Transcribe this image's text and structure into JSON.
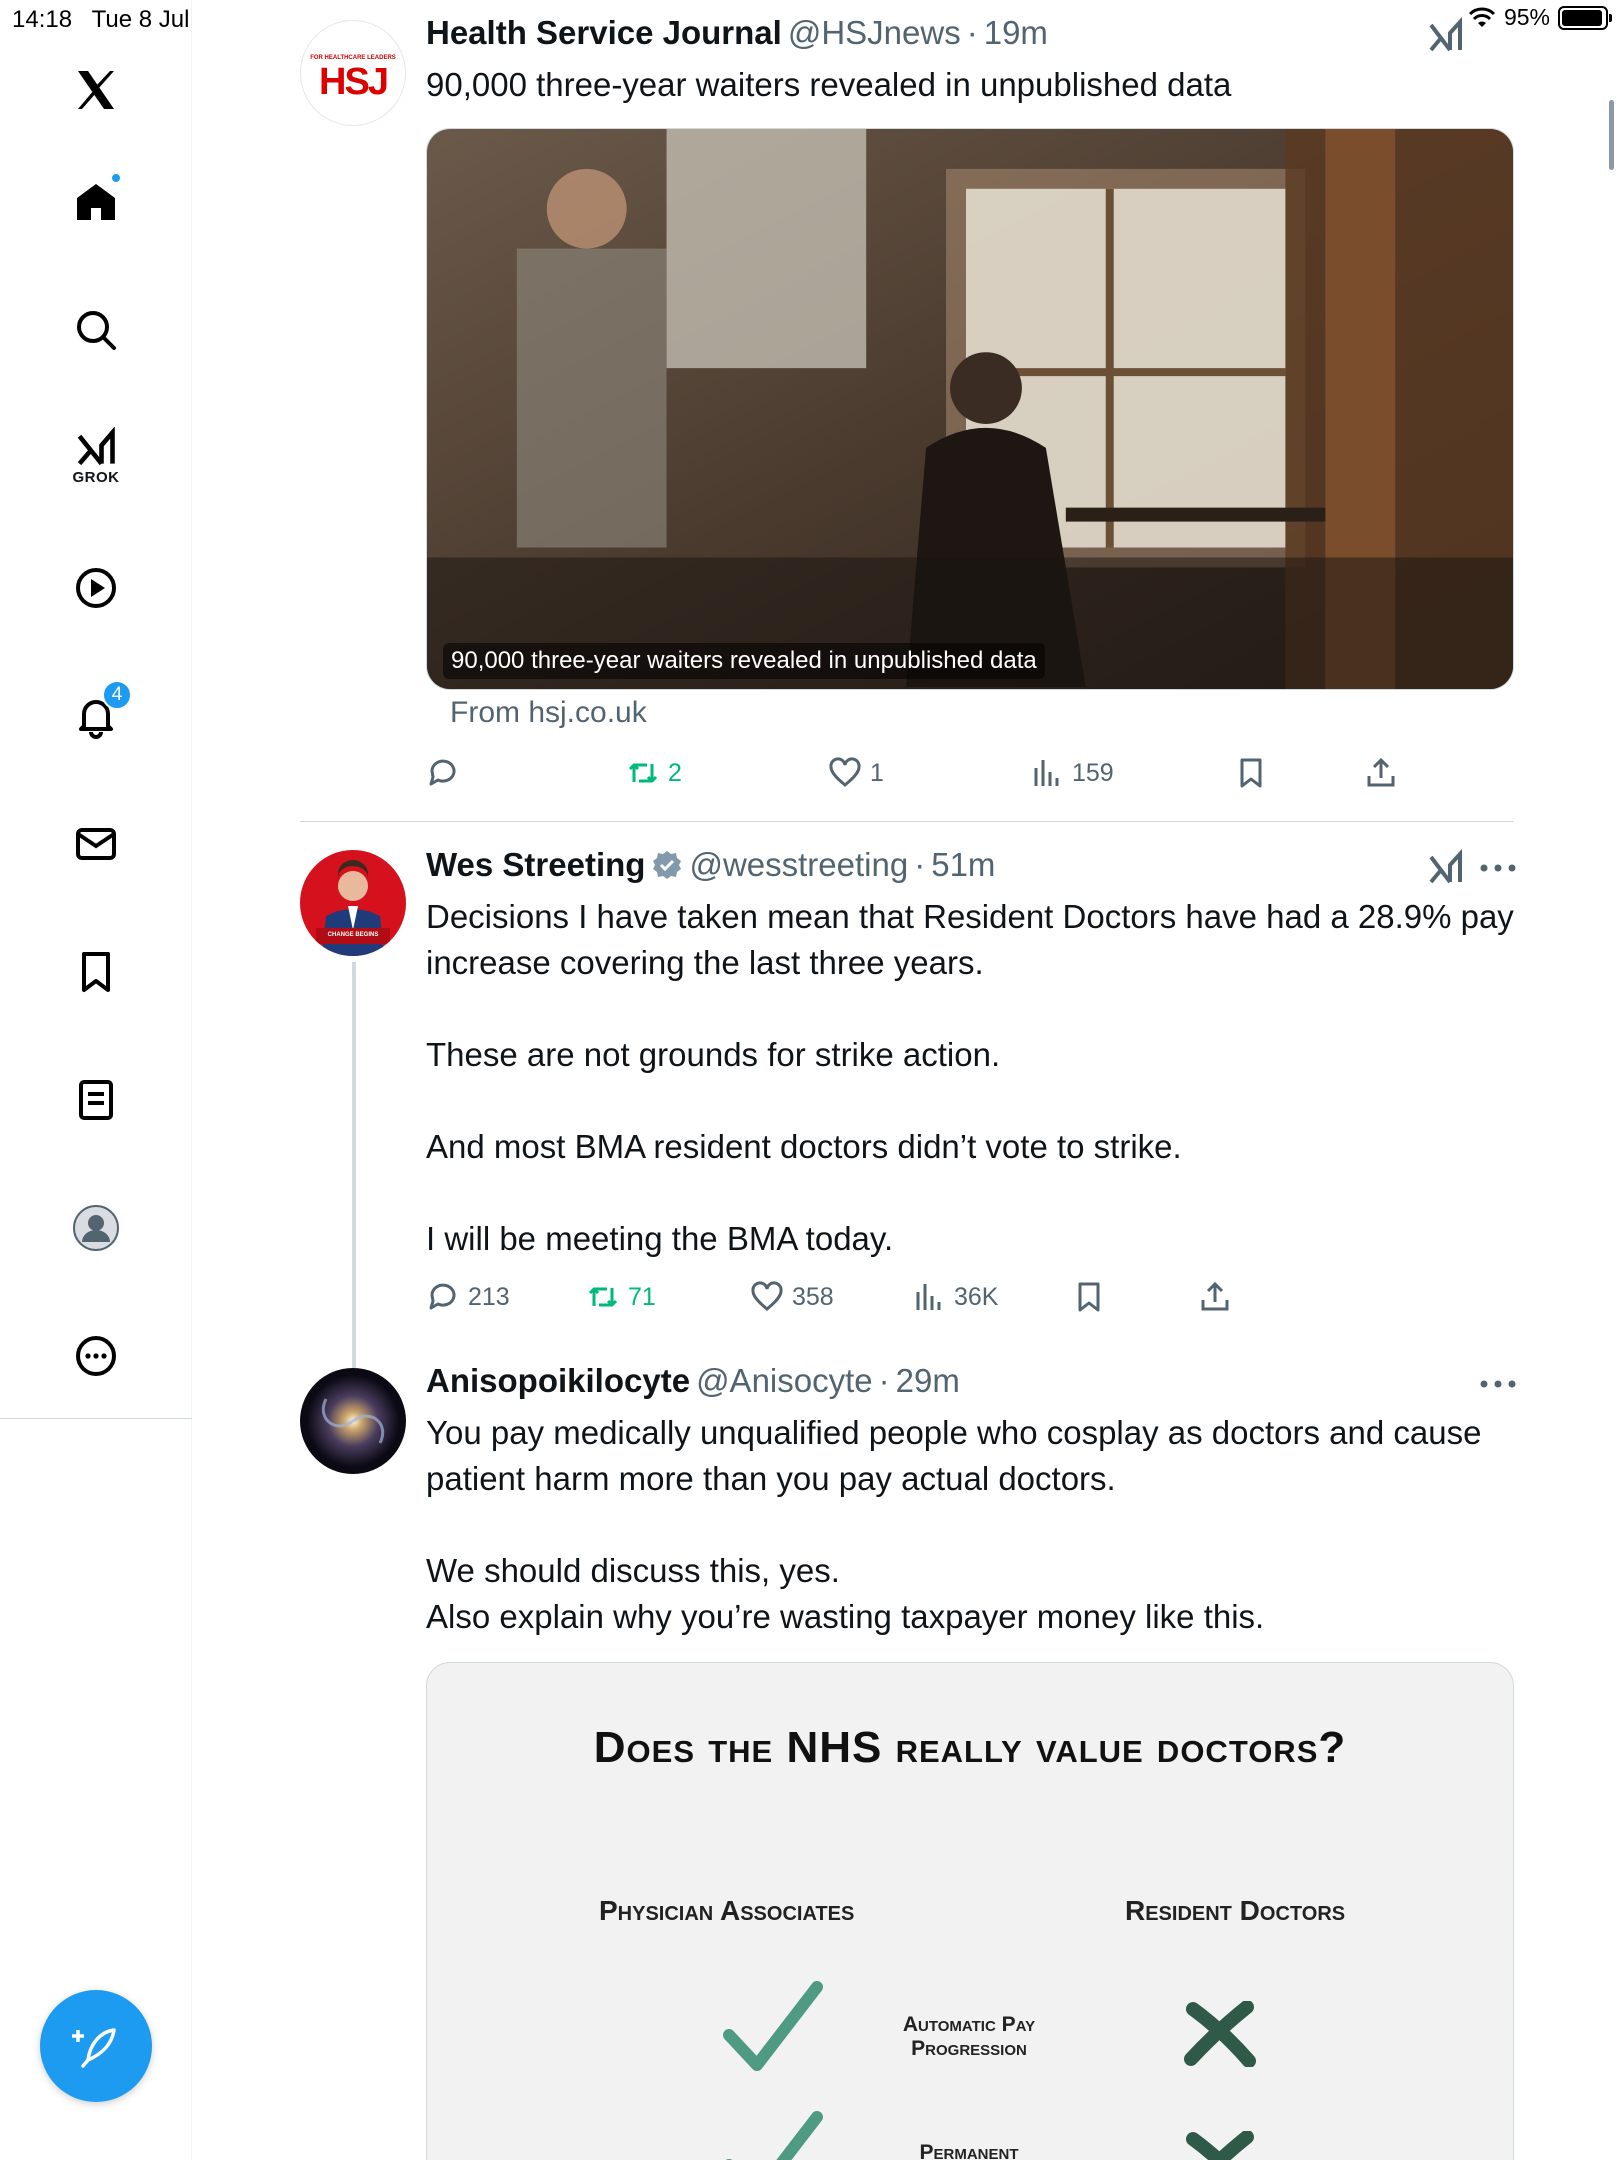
{
  "status_bar": {
    "time": "14:18",
    "date": "Tue 8 Jul",
    "battery": "95%",
    "battery_level": 0.95
  },
  "sidebar": {
    "grok_label": "GROK",
    "notifications_count": "4"
  },
  "tweets": [
    {
      "name": "Health Service Journal",
      "handle": "@HSJnews",
      "time": "19m",
      "text": "90,000 three-year waiters revealed in unpublished data",
      "avatar_text": "HSJ",
      "avatar_tagline": "FOR HEALTHCARE LEADERS",
      "card": {
        "overlay_title": "90,000 three-year waiters revealed in unpublished data",
        "source": "From hsj.co.uk"
      },
      "stats": {
        "reposts": "2",
        "likes": "1",
        "views": "159"
      }
    },
    {
      "name": "Wes Streeting",
      "handle": "@wesstreeting",
      "time": "51m",
      "verified": true,
      "paragraphs": [
        "Decisions I have taken mean that Resident Doctors have had a 28.9% pay increase covering the last three years.",
        "These are not grounds for strike action.",
        "And most BMA resident doctors didn’t vote to strike.",
        "I will be meeting the BMA today."
      ],
      "avatar_banner": "CHANGE BEGINS",
      "stats": {
        "replies": "213",
        "reposts": "71",
        "likes": "358",
        "views": "36K"
      }
    },
    {
      "name": "Anisopoikilocyte",
      "handle": "@Anisocyte",
      "time": "29m",
      "paragraphs": [
        "You pay medically unqualified people who cosplay as doctors and cause patient harm more than you pay actual doctors.",
        "",
        "We should discuss this, yes.",
        "Also explain why you’re wasting taxpayer money like this."
      ],
      "infographic": {
        "title": "Does the NHS really value doctors?",
        "col_left": "Physician Associates",
        "col_right": "Resident Doctors",
        "rows": [
          "Automatic Pay Progression",
          "Permanent"
        ]
      }
    }
  ],
  "separator": "·"
}
